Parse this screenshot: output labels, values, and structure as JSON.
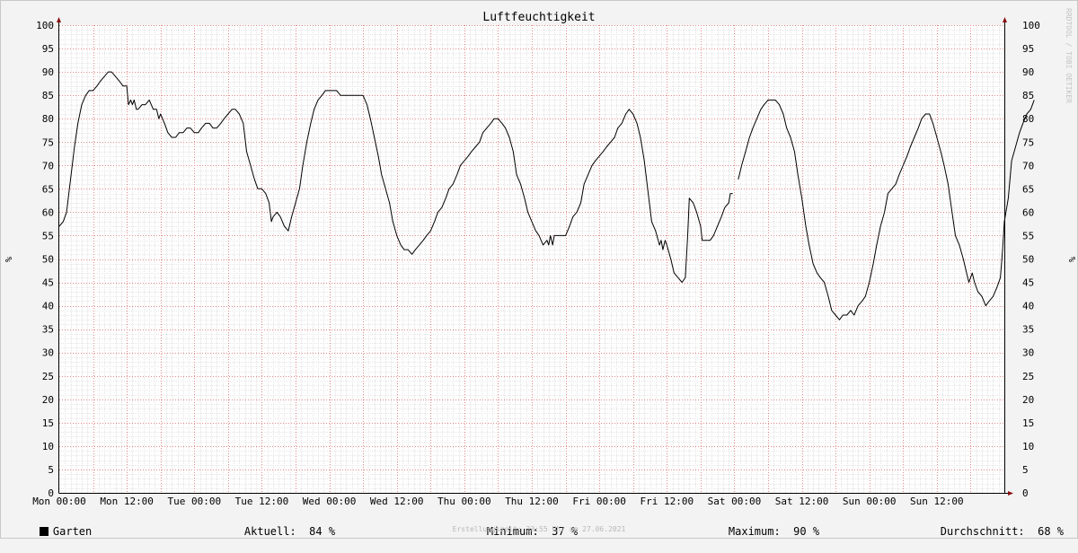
{
  "chart_data": {
    "type": "line",
    "title": "Luftfeuchtigkeit",
    "ylabel": "%",
    "ylim": [
      0,
      100
    ],
    "yticks": [
      0,
      5,
      10,
      15,
      20,
      25,
      30,
      35,
      40,
      45,
      50,
      55,
      60,
      65,
      70,
      75,
      80,
      85,
      90,
      95,
      100
    ],
    "xlim": [
      0,
      168
    ],
    "xticks": [
      {
        "t": 0,
        "label": "Mon 00:00"
      },
      {
        "t": 12,
        "label": "Mon 12:00"
      },
      {
        "t": 24,
        "label": "Tue 00:00"
      },
      {
        "t": 36,
        "label": "Tue 12:00"
      },
      {
        "t": 48,
        "label": "Wed 00:00"
      },
      {
        "t": 60,
        "label": "Wed 12:00"
      },
      {
        "t": 72,
        "label": "Thu 00:00"
      },
      {
        "t": 84,
        "label": "Thu 12:00"
      },
      {
        "t": 96,
        "label": "Fri 00:00"
      },
      {
        "t": 108,
        "label": "Fri 12:00"
      },
      {
        "t": 120,
        "label": "Sat 00:00"
      },
      {
        "t": 132,
        "label": "Sat 12:00"
      },
      {
        "t": 144,
        "label": "Sun 00:00"
      },
      {
        "t": 156,
        "label": "Sun 12:00"
      }
    ],
    "grid": true,
    "watermark": "RRDTOOL / TOBI OETIKER",
    "series": [
      {
        "name": "Garten",
        "color": "#000000",
        "segments": [
          [
            [
              0,
              57
            ],
            [
              0.7,
              58
            ],
            [
              1.3,
              60
            ],
            [
              2,
              67
            ],
            [
              2.7,
              74
            ],
            [
              3.3,
              79
            ],
            [
              4,
              83
            ],
            [
              4.7,
              85
            ],
            [
              5.3,
              86
            ],
            [
              6,
              86
            ],
            [
              6.7,
              87
            ],
            [
              7.3,
              88
            ],
            [
              8,
              89
            ],
            [
              8.7,
              90
            ],
            [
              9.3,
              90
            ],
            [
              10,
              89
            ],
            [
              10.7,
              88
            ],
            [
              11.3,
              87
            ],
            [
              12,
              87
            ],
            [
              12.3,
              83
            ],
            [
              12.7,
              84
            ],
            [
              13,
              83
            ],
            [
              13.3,
              84
            ],
            [
              13.7,
              82
            ],
            [
              14,
              82
            ],
            [
              14.7,
              83
            ],
            [
              15.3,
              83
            ],
            [
              16,
              84
            ],
            [
              16.7,
              82
            ],
            [
              17.3,
              82
            ],
            [
              17.7,
              80
            ],
            [
              18,
              81
            ],
            [
              18.7,
              79
            ],
            [
              19.3,
              77
            ],
            [
              20,
              76
            ],
            [
              20.7,
              76
            ],
            [
              21.3,
              77
            ],
            [
              22,
              77
            ],
            [
              22.7,
              78
            ],
            [
              23.3,
              78
            ],
            [
              24,
              77
            ],
            [
              24.7,
              77
            ],
            [
              25.3,
              78
            ],
            [
              26,
              79
            ],
            [
              26.7,
              79
            ],
            [
              27.3,
              78
            ],
            [
              28,
              78
            ],
            [
              28.7,
              79
            ],
            [
              29.3,
              80
            ],
            [
              30,
              81
            ],
            [
              30.7,
              82
            ],
            [
              31.3,
              82
            ],
            [
              32,
              81
            ],
            [
              32.7,
              79
            ],
            [
              33.3,
              73
            ],
            [
              34,
              70
            ],
            [
              34.7,
              67
            ],
            [
              35.3,
              65
            ],
            [
              36,
              65
            ],
            [
              36.7,
              64
            ],
            [
              37.3,
              62
            ],
            [
              37.7,
              58
            ],
            [
              38,
              59
            ],
            [
              38.7,
              60
            ],
            [
              39.3,
              59
            ],
            [
              40,
              57
            ],
            [
              40.7,
              56
            ],
            [
              41.3,
              59
            ],
            [
              42,
              62
            ],
            [
              42.7,
              65
            ],
            [
              43.3,
              70
            ],
            [
              44,
              75
            ],
            [
              44.7,
              79
            ],
            [
              45.3,
              82
            ],
            [
              46,
              84
            ],
            [
              46.7,
              85
            ],
            [
              47.3,
              86
            ],
            [
              48,
              86
            ],
            [
              48.7,
              86
            ],
            [
              49.3,
              86
            ],
            [
              50,
              85
            ],
            [
              51,
              85
            ],
            [
              52,
              85
            ],
            [
              53,
              85
            ],
            [
              54,
              85
            ],
            [
              54.7,
              83
            ],
            [
              55.3,
              80
            ],
            [
              56,
              76
            ],
            [
              56.7,
              72
            ],
            [
              57.3,
              68
            ],
            [
              58,
              65
            ],
            [
              58.7,
              62
            ],
            [
              59.3,
              58
            ],
            [
              60,
              55
            ],
            [
              60.7,
              53
            ],
            [
              61.3,
              52
            ],
            [
              62,
              52
            ],
            [
              62.7,
              51
            ],
            [
              63.3,
              52
            ],
            [
              64,
              53
            ],
            [
              64.7,
              54
            ],
            [
              65.3,
              55
            ],
            [
              66,
              56
            ],
            [
              66.7,
              58
            ],
            [
              67.3,
              60
            ],
            [
              68,
              61
            ],
            [
              68.7,
              63
            ],
            [
              69.3,
              65
            ],
            [
              70,
              66
            ],
            [
              70.7,
              68
            ],
            [
              71.3,
              70
            ],
            [
              72,
              71
            ],
            [
              72.7,
              72
            ],
            [
              73.3,
              73
            ],
            [
              74,
              74
            ],
            [
              74.7,
              75
            ],
            [
              75.3,
              77
            ],
            [
              76,
              78
            ],
            [
              76.7,
              79
            ],
            [
              77.3,
              80
            ],
            [
              78,
              80
            ],
            [
              78.7,
              79
            ],
            [
              79.3,
              78
            ],
            [
              80,
              76
            ],
            [
              80.7,
              73
            ],
            [
              81.3,
              68
            ],
            [
              82,
              66
            ],
            [
              82.7,
              63
            ],
            [
              83.3,
              60
            ],
            [
              84,
              58
            ],
            [
              84.7,
              56
            ],
            [
              85.3,
              55
            ],
            [
              86,
              53
            ],
            [
              86.7,
              54
            ],
            [
              87,
              53
            ],
            [
              87.3,
              55
            ],
            [
              87.7,
              53
            ],
            [
              88,
              55
            ],
            [
              88.7,
              55
            ],
            [
              89.3,
              55
            ],
            [
              90,
              55
            ],
            [
              90.7,
              57
            ],
            [
              91.3,
              59
            ],
            [
              92,
              60
            ],
            [
              92.7,
              62
            ],
            [
              93.3,
              66
            ],
            [
              94,
              68
            ],
            [
              94.7,
              70
            ],
            [
              95.3,
              71
            ],
            [
              96,
              72
            ],
            [
              96.7,
              73
            ],
            [
              97.3,
              74
            ],
            [
              98,
              75
            ],
            [
              98.7,
              76
            ],
            [
              99.3,
              78
            ],
            [
              100,
              79
            ],
            [
              100.7,
              81
            ],
            [
              101.3,
              82
            ],
            [
              102,
              81
            ],
            [
              102.7,
              79
            ],
            [
              103.3,
              76
            ],
            [
              104,
              71
            ],
            [
              104.7,
              64
            ],
            [
              105.3,
              58
            ],
            [
              106,
              56
            ],
            [
              106.7,
              53
            ],
            [
              107,
              54
            ],
            [
              107.3,
              52
            ],
            [
              107.7,
              54
            ],
            [
              108,
              53
            ],
            [
              108.7,
              50
            ],
            [
              109.3,
              47
            ],
            [
              110,
              46
            ],
            [
              110.7,
              45
            ],
            [
              111.3,
              46
            ],
            [
              111.7,
              55
            ],
            [
              112,
              63
            ],
            [
              112.7,
              62
            ],
            [
              113.3,
              60
            ],
            [
              114,
              57
            ],
            [
              114.3,
              54
            ],
            [
              115,
              54
            ],
            [
              115.7,
              54
            ],
            [
              116.3,
              55
            ],
            [
              117,
              57
            ],
            [
              117.7,
              59
            ],
            [
              118.3,
              61
            ],
            [
              119,
              62
            ],
            [
              119.3,
              64
            ],
            [
              119.7,
              64
            ]
          ],
          [
            [
              120.7,
              67
            ],
            [
              121.3,
              70
            ],
            [
              122,
              73
            ],
            [
              122.7,
              76
            ],
            [
              123.3,
              78
            ],
            [
              124,
              80
            ],
            [
              124.7,
              82
            ],
            [
              125.3,
              83
            ],
            [
              126,
              84
            ],
            [
              126.7,
              84
            ],
            [
              127.3,
              84
            ],
            [
              128,
              83
            ],
            [
              128.7,
              81
            ],
            [
              129.3,
              78
            ],
            [
              130,
              76
            ],
            [
              130.7,
              73
            ],
            [
              131.3,
              68
            ],
            [
              132,
              63
            ],
            [
              132.7,
              57
            ],
            [
              133.3,
              53
            ],
            [
              134,
              49
            ],
            [
              134.7,
              47
            ],
            [
              135.3,
              46
            ],
            [
              136,
              45
            ],
            [
              136.7,
              42
            ],
            [
              137.3,
              39
            ],
            [
              138,
              38
            ],
            [
              138.7,
              37
            ],
            [
              139.3,
              38
            ],
            [
              140,
              38
            ],
            [
              140.7,
              39
            ],
            [
              141.3,
              38
            ],
            [
              142,
              40
            ],
            [
              142.7,
              41
            ],
            [
              143.3,
              42
            ],
            [
              144,
              45
            ],
            [
              144.7,
              49
            ],
            [
              145.3,
              53
            ],
            [
              146,
              57
            ],
            [
              146.7,
              60
            ],
            [
              147.3,
              64
            ],
            [
              148,
              65
            ],
            [
              148.7,
              66
            ],
            [
              149.3,
              68
            ],
            [
              150,
              70
            ],
            [
              150.7,
              72
            ],
            [
              151.3,
              74
            ],
            [
              152,
              76
            ],
            [
              152.7,
              78
            ],
            [
              153.3,
              80
            ],
            [
              154,
              81
            ],
            [
              154.7,
              81
            ],
            [
              155.3,
              79
            ],
            [
              156,
              76
            ],
            [
              156.7,
              73
            ],
            [
              157.3,
              70
            ],
            [
              158,
              66
            ],
            [
              158.7,
              60
            ],
            [
              159.3,
              55
            ],
            [
              160,
              53
            ],
            [
              160.7,
              50
            ],
            [
              161.3,
              47
            ],
            [
              161.7,
              45
            ],
            [
              162,
              46
            ],
            [
              162.3,
              47
            ],
            [
              162.7,
              45
            ],
            [
              163.3,
              43
            ],
            [
              164,
              42
            ],
            [
              164.7,
              40
            ],
            [
              165.3,
              41
            ],
            [
              166,
              42
            ],
            [
              166.7,
              44
            ],
            [
              167.3,
              46
            ],
            [
              167.7,
              52
            ],
            [
              168,
              58
            ],
            [
              168.7,
              63
            ],
            [
              169.3,
              71
            ],
            [
              170,
              74
            ],
            [
              170.7,
              77
            ],
            [
              171.3,
              79
            ],
            [
              172,
              81
            ],
            [
              172.7,
              82
            ],
            [
              173.3,
              84
            ]
          ]
        ]
      }
    ],
    "legend": {
      "series_name": "Garten",
      "current_label": "Aktuell:",
      "current_value": "84 %",
      "min_label": "Minimum:",
      "min_value": "37 %",
      "max_label": "Maximum:",
      "max_value": "90 %",
      "avg_label": "Durchschnitt:",
      "avg_value": "68 %"
    },
    "footer": "Erstellungszeit: 23:55 Uhr am 27.06.2021"
  }
}
